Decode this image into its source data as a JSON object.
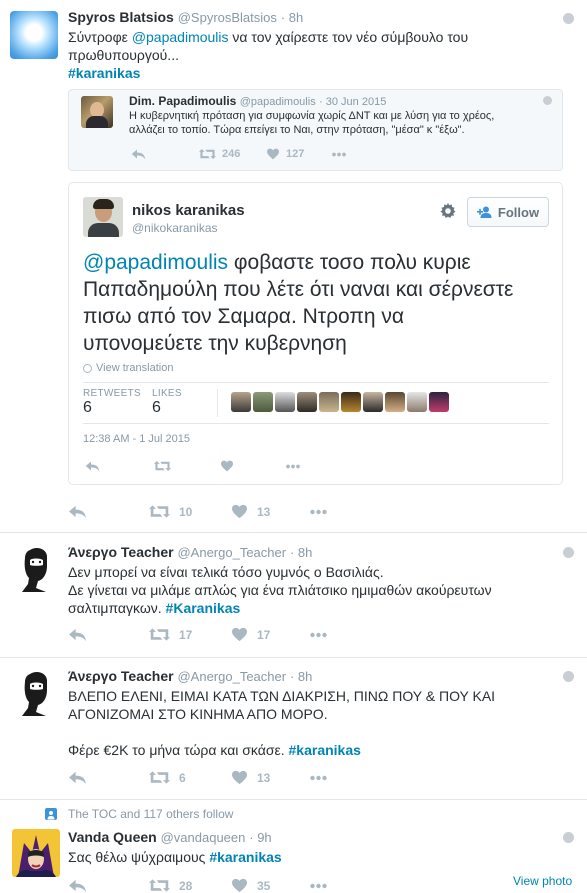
{
  "tweet1": {
    "name": "Spyros Blatsios",
    "handle": "@SpyrosBlatsios",
    "time": "· 8h",
    "text_pre": "Σύντροφε ",
    "mention": "@papadimoulis",
    "text_post": " να τον χαίρεστε τον νέο σύμβουλο του πρωθυπουργού...",
    "hashtag": "#karanikas",
    "retweets": "10",
    "likes": "13",
    "quote": {
      "name": "Dim. Papadimoulis",
      "handle": "@papadimoulis",
      "time": "· 30 Jun 2015",
      "line1": "Η κυβερνητική πρόταση για συμφωνία χωρίς ΔΝΤ και με λύση για το χρέος,",
      "line2": "αλλάζει το τοπίο. Τώρα επείγει το Ναι, στην πρόταση, \"μέσα\" κ \"έξω\".",
      "retweets": "246",
      "likes": "127"
    },
    "card": {
      "name": "nikos karanikas",
      "handle": "@nikokaranikas",
      "follow_label": "Follow",
      "text_mention": "@papadimoulis",
      "text_line1_rest": " φοβαστε τοσο πολυ κυριε",
      "text_line2": "Παπαδημούλη που λέτε ότι ναναι και σέρνεστε",
      "text_line3": "πισω από τον Σαμαρα. Ντροπη να",
      "text_line4": "υπονομεύετε την κυβερνηση",
      "view_translation": "View translation",
      "retweets_label": "RETWEETS",
      "retweets": "6",
      "likes_label": "LIKES",
      "likes": "6",
      "timestamp": "12:38 AM - 1 Jul 2015"
    }
  },
  "tweet2": {
    "name": "Άνεργο Teacher",
    "handle": "@Anergo_Teacher",
    "time": "· 8h",
    "line1": "Δεν μπορεί να είναι τελικά τόσο γυμνός ο Βασιλιάς.",
    "line2": "Δε γίνεται να μιλάμε απλώς για ένα πλιάτσικο ημιμαθών ακούρευτων",
    "line3": "σαλτιμπαγκων. ",
    "hashtag": "#Karanikas",
    "retweets": "17",
    "likes": "17"
  },
  "tweet3": {
    "name": "Άνεργο Teacher",
    "handle": "@Anergo_Teacher",
    "time": "· 8h",
    "line1": "ΒΛΕΠΟ ΕΛΕΝΙ, ΕΙΜΑΙ ΚΑΤΑ ΤΩΝ ΔΙΑΚΡΙΣΗ, ΠΙΝΩ ΠΟΥ & ΠΟΥ ΚΑΙ",
    "line2": "ΑΓΟΝΙΖΟΜΑΙ ΣΤΟ ΚΙΝΗΜΑ ΑΠΟ ΜΟΡΟ.",
    "line3": "Φέρε €2Κ το μήνα τώρα και σκάσε. ",
    "hashtag": "#karanikas",
    "retweets": "6",
    "likes": "13"
  },
  "tweet4": {
    "follow_context": "The TOC and 117 others follow",
    "name": "Vanda Queen",
    "handle": "@vandaqueen",
    "time": "· 9h",
    "text": "Σας θέλω ψύχραιμους ",
    "hashtag": "#karanikas",
    "retweets": "28",
    "likes": "35",
    "view_photo": "View photo"
  },
  "colors": {
    "link": "#0084b4",
    "muted": "#8899a6",
    "icon": "#aab8c2"
  }
}
